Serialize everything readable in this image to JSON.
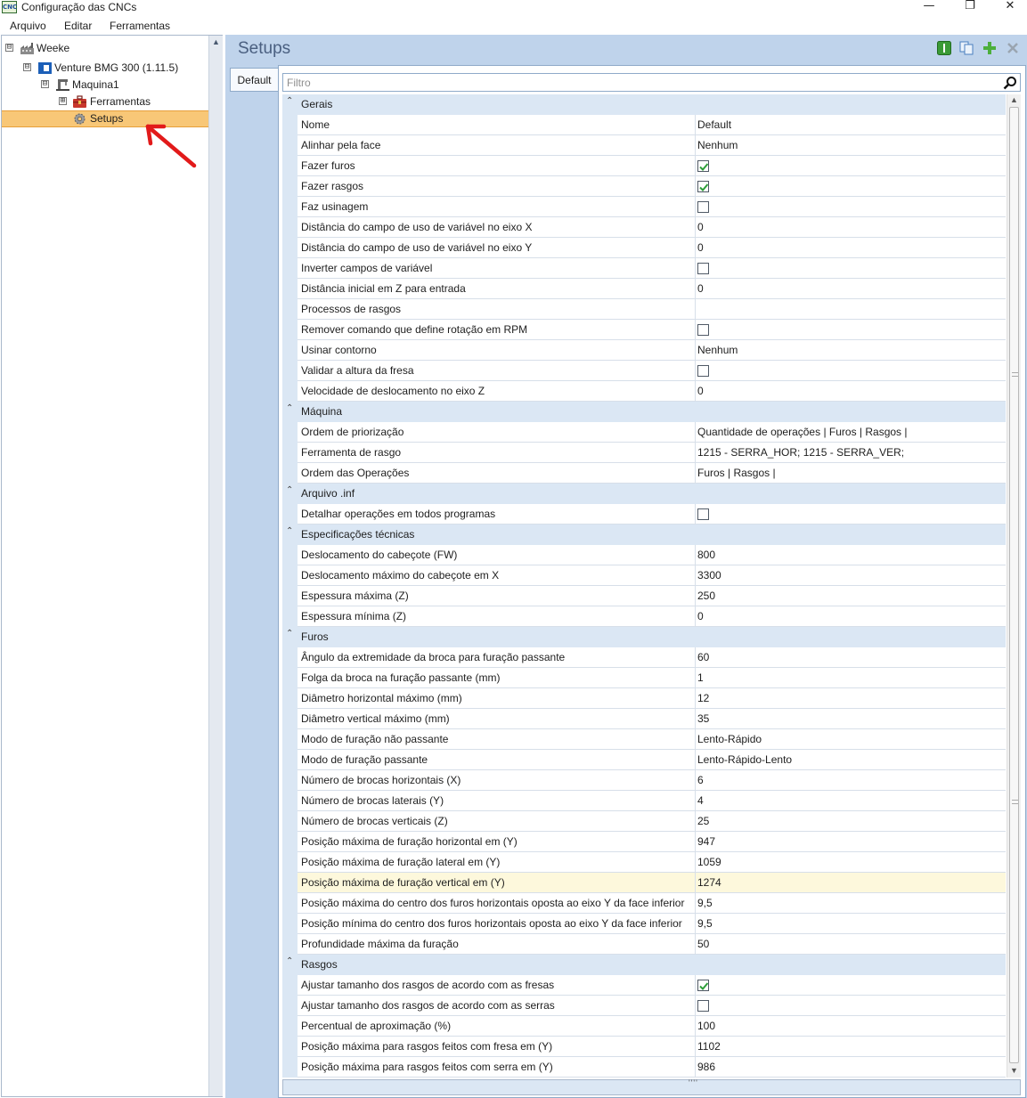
{
  "window": {
    "title": "Configuração das CNCs",
    "minimize": "—",
    "restore": "❐",
    "close": "✕"
  },
  "menu": [
    "Arquivo",
    "Editar",
    "Ferramentas"
  ],
  "tree": [
    {
      "label": "Weeke",
      "expander": "⊟"
    },
    {
      "label": "Venture BMG 300 (1.11.5)",
      "expander": "⊟"
    },
    {
      "label": "Maquina1",
      "expander": "⊟"
    },
    {
      "label": "Ferramentas",
      "expander": "⊞"
    },
    {
      "label": "Setups",
      "selected": true
    }
  ],
  "panel": {
    "title": "Setups",
    "tab": "Default",
    "filter_placeholder": "Filtro"
  },
  "colors": {
    "accent": "#bfd3eb",
    "selection": "#f8c777",
    "category_bg": "#dbe7f4",
    "highlight_row": "#fdf8dc",
    "check_green": "#2e9e3a"
  },
  "icons": [
    "info-icon",
    "copy-icon",
    "add-icon",
    "delete-icon",
    "search-icon",
    "cog-icon",
    "factory-icon",
    "machine-icon",
    "toolbox-icon"
  ],
  "categories": [
    {
      "name": "Gerais",
      "rows": [
        {
          "name": "Nome",
          "value": "Default"
        },
        {
          "name": "Alinhar pela face",
          "value": "Nenhum"
        },
        {
          "name": "Fazer furos",
          "checkbox": true,
          "checked": true
        },
        {
          "name": "Fazer rasgos",
          "checkbox": true,
          "checked": true
        },
        {
          "name": "Faz usinagem",
          "checkbox": true,
          "checked": false
        },
        {
          "name": "Distância do campo de uso de variável no eixo X",
          "value": "0"
        },
        {
          "name": "Distância do campo de uso de variável no eixo Y",
          "value": "0"
        },
        {
          "name": "Inverter campos de variável",
          "checkbox": true,
          "checked": false
        },
        {
          "name": "Distância inicial em Z para entrada",
          "value": "0"
        },
        {
          "name": "Processos de rasgos",
          "value": ""
        },
        {
          "name": "Remover comando que define rotação em RPM",
          "checkbox": true,
          "checked": false
        },
        {
          "name": "Usinar contorno",
          "value": "Nenhum"
        },
        {
          "name": "Validar a altura da fresa",
          "checkbox": true,
          "checked": false
        },
        {
          "name": "Velocidade de deslocamento no eixo Z",
          "value": "0"
        }
      ]
    },
    {
      "name": "Máquina",
      "rows": [
        {
          "name": "Ordem de priorização",
          "value": "Quantidade de operações | Furos | Rasgos |"
        },
        {
          "name": "Ferramenta de rasgo",
          "value": "1215 - SERRA_HOR; 1215 - SERRA_VER;"
        },
        {
          "name": "Ordem das Operações",
          "value": "Furos | Rasgos |"
        }
      ]
    },
    {
      "name": "Arquivo .inf",
      "rows": [
        {
          "name": "Detalhar operações em todos programas",
          "checkbox": true,
          "checked": false
        }
      ]
    },
    {
      "name": "Especificações técnicas",
      "rows": [
        {
          "name": "Deslocamento do cabeçote (FW)",
          "value": "800"
        },
        {
          "name": "Deslocamento máximo do cabeçote em X",
          "value": "3300"
        },
        {
          "name": "Espessura máxima (Z)",
          "value": "250"
        },
        {
          "name": "Espessura mínima (Z)",
          "value": "0"
        }
      ]
    },
    {
      "name": "Furos",
      "rows": [
        {
          "name": "Ângulo da extremidade da broca para furação passante",
          "value": "60"
        },
        {
          "name": "Folga da broca na furação passante (mm)",
          "value": "1"
        },
        {
          "name": "Diâmetro horizontal máximo (mm)",
          "value": "12"
        },
        {
          "name": "Diâmetro vertical máximo (mm)",
          "value": "35"
        },
        {
          "name": "Modo de furação não passante",
          "value": "Lento-Rápido"
        },
        {
          "name": "Modo de furação passante",
          "value": "Lento-Rápido-Lento"
        },
        {
          "name": "Número de brocas horizontais (X)",
          "value": "6"
        },
        {
          "name": "Número de brocas laterais (Y)",
          "value": "4"
        },
        {
          "name": "Número de brocas verticais (Z)",
          "value": "25"
        },
        {
          "name": "Posição máxima de furação horizontal em (Y)",
          "value": "947"
        },
        {
          "name": "Posição máxima de furação lateral em (Y)",
          "value": "1059"
        },
        {
          "name": "Posição máxima de furação vertical em (Y)",
          "value": "1274",
          "highlight": true
        },
        {
          "name": "Posição máxima do centro dos furos horizontais oposta ao eixo Y da face inferior",
          "value": "9,5"
        },
        {
          "name": "Posição mínima do centro dos furos horizontais oposta ao eixo Y da face inferior",
          "value": "9,5"
        },
        {
          "name": "Profundidade máxima da furação",
          "value": "50"
        }
      ]
    },
    {
      "name": "Rasgos",
      "rows": [
        {
          "name": "Ajustar tamanho dos rasgos de acordo com as fresas",
          "checkbox": true,
          "checked": true
        },
        {
          "name": "Ajustar tamanho dos rasgos de acordo com as serras",
          "checkbox": true,
          "checked": false
        },
        {
          "name": "Percentual de aproximação (%)",
          "value": "100"
        },
        {
          "name": "Posição máxima para rasgos feitos com fresa em (Y)",
          "value": "1102"
        },
        {
          "name": "Posição máxima para rasgos feitos com serra em (Y)",
          "value": "986"
        }
      ]
    }
  ]
}
